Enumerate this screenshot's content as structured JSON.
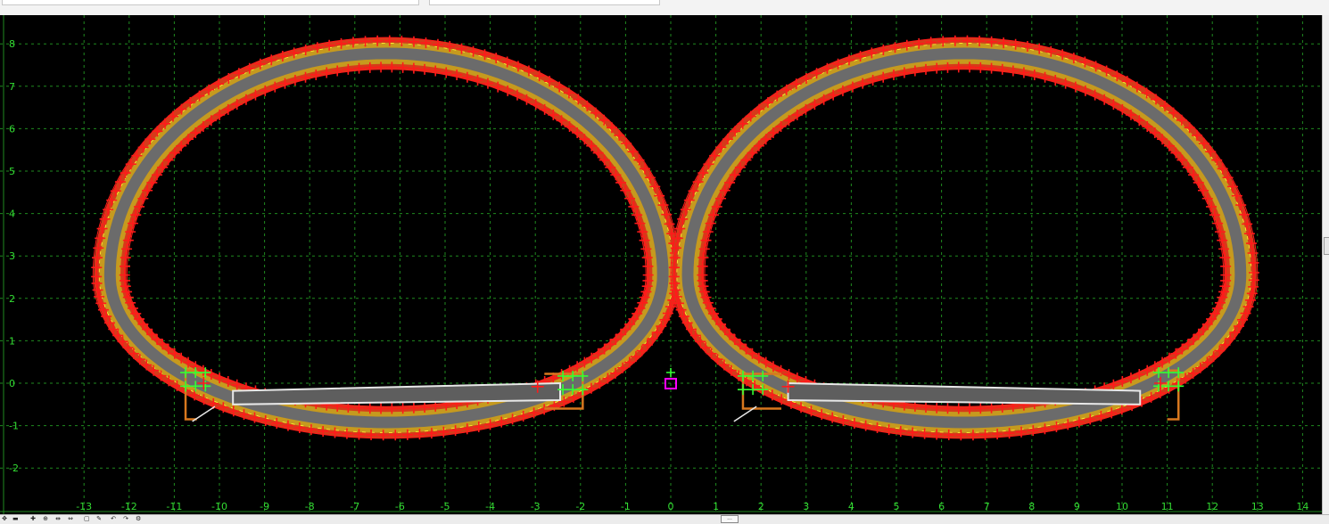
{
  "toolbar": {
    "icons": [
      "move-icon",
      "pan-icon",
      "zoom-in-icon",
      "zoom-window-icon",
      "fit-icon",
      "fit-all-icon",
      "view-icon",
      "measure-icon",
      "undo-icon",
      "redo-icon",
      "settings-icon"
    ],
    "scroll_grip": "..."
  },
  "colors": {
    "background": "#000000",
    "grid": "#1f8a1f",
    "axis_text": "#33dd33",
    "lining_outer": "#d63a1a",
    "lining_mid": "#c69a1e",
    "lining_core": "#6b6b6b",
    "point_red": "#ff1a1a",
    "point_green": "#33ff33",
    "curb": "#d8771e",
    "pavement": "#5e5e5e",
    "pavement_edge": "#e8e8e8",
    "marker": "#ff00ff",
    "drain_yellow": "#ffff33"
  },
  "chart_data": {
    "type": "scatter",
    "title": "",
    "xlabel": "",
    "ylabel": "",
    "xlim": [
      -13.5,
      14.5
    ],
    "ylim": [
      -2.5,
      8.3
    ],
    "grid": true,
    "x_ticks": [
      -13,
      -12,
      -11,
      -10,
      -9,
      -8,
      -7,
      -6,
      -5,
      -4,
      -3,
      -2,
      -1,
      0,
      1,
      2,
      3,
      4,
      5,
      6,
      7,
      8,
      9,
      10,
      11,
      12,
      13,
      14
    ],
    "x_tick_labels": [
      "-13",
      "-12",
      "-11",
      "-10",
      "-9",
      "-8",
      "-7",
      "-6",
      "-5",
      "-4",
      "-3",
      "-2",
      "-1",
      "0",
      "1",
      "2",
      "3",
      "4",
      "5",
      "6",
      "7",
      "8",
      "9",
      "10",
      "11",
      "12",
      "13",
      "14"
    ],
    "y_ticks": [
      -2,
      -1,
      0,
      1,
      2,
      3,
      4,
      5,
      6,
      7,
      8
    ],
    "y_tick_labels": [
      "-2",
      "-1",
      "0",
      "1",
      "2",
      "3",
      "4",
      "5",
      "6",
      "7",
      "8"
    ],
    "tunnels": [
      {
        "name": "left-tunnel",
        "center": [
          -6.3,
          2.55
        ],
        "radius_x": 5.75,
        "radius_top": 4.85,
        "radius_bottom": 3.1,
        "lining_thickness": 0.75,
        "road": {
          "x1": -9.7,
          "x2": -2.45,
          "y_top_left": -0.18,
          "y_top_right": 0.0,
          "y_bottom_left": -0.5,
          "y_bottom_right": -0.4
        },
        "left_curb": {
          "x": -10.75,
          "y_top": 0.3,
          "y_bottom": -0.85
        },
        "right_curb": {
          "x": -1.95,
          "y_top": 0.22,
          "y_bottom": -0.6
        }
      },
      {
        "name": "right-tunnel",
        "center": [
          6.5,
          2.55
        ],
        "radius_x": 5.75,
        "radius_top": 4.85,
        "radius_bottom": 3.1,
        "lining_thickness": 0.75,
        "road": {
          "x1": 2.6,
          "x2": 10.4,
          "y_top_left": 0.0,
          "y_top_right": -0.18,
          "y_bottom_left": -0.4,
          "y_bottom_right": -0.5
        },
        "left_curb": {
          "x": 1.6,
          "y_top": 0.22,
          "y_bottom": -0.6
        },
        "right_curb": {
          "x": 11.25,
          "y_top": 0.3,
          "y_bottom": -0.85
        }
      }
    ],
    "marker": {
      "name": "origin-marker",
      "x": 0.0,
      "y": 0.0
    }
  }
}
